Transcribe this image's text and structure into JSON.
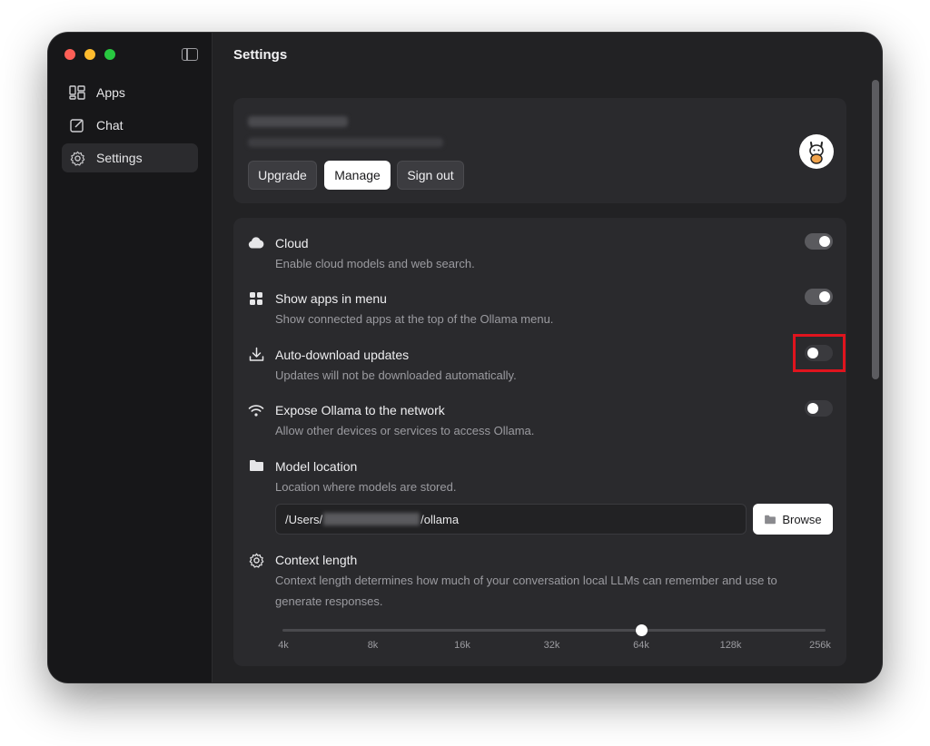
{
  "sidebar": {
    "items": [
      {
        "label": "Apps",
        "icon": "apps-icon"
      },
      {
        "label": "Chat",
        "icon": "edit-icon"
      },
      {
        "label": "Settings",
        "icon": "gear-icon"
      }
    ],
    "active": "Settings"
  },
  "header": {
    "title": "Settings"
  },
  "account": {
    "upgrade_label": "Upgrade",
    "manage_label": "Manage",
    "signout_label": "Sign out",
    "avatar_icon": "llama-avatar-icon"
  },
  "settings": [
    {
      "key": "cloud",
      "title": "Cloud",
      "desc": "Enable cloud models and web search.",
      "enabled": true,
      "icon": "cloud-icon"
    },
    {
      "key": "show_apps",
      "title": "Show apps in menu",
      "desc": "Show connected apps at the top of the Ollama menu.",
      "enabled": true,
      "icon": "grid-icon"
    },
    {
      "key": "auto_download",
      "title": "Auto-download updates",
      "desc": "Updates will not be downloaded automatically.",
      "enabled": false,
      "icon": "download-icon"
    },
    {
      "key": "expose",
      "title": "Expose Ollama to the network",
      "desc": "Allow other devices or services to access Ollama.",
      "enabled": false,
      "icon": "wifi-icon"
    }
  ],
  "model_location": {
    "title": "Model location",
    "desc": "Location where models are stored.",
    "path_prefix": "/Users/",
    "path_suffix": "/ollama",
    "browse_label": "Browse"
  },
  "context_length": {
    "title": "Context length",
    "desc": "Context length determines how much of your conversation local LLMs can remember and use to generate responses.",
    "ticks": [
      "4k",
      "8k",
      "16k",
      "32k",
      "64k",
      "128k",
      "256k"
    ],
    "value": "64k"
  },
  "colors": {
    "accent_highlight": "#e0141e",
    "background": "#222224"
  }
}
